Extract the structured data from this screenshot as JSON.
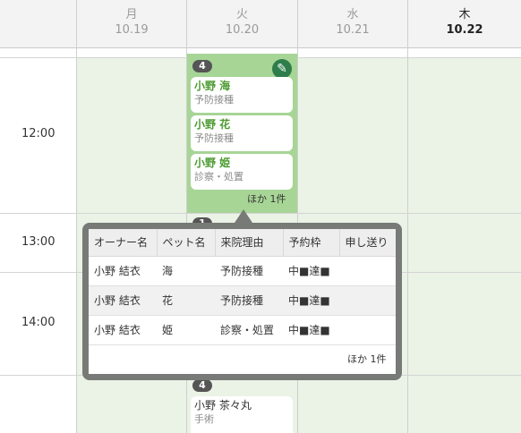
{
  "header": {
    "days": [
      {
        "dow": "月",
        "date": "10.19"
      },
      {
        "dow": "火",
        "date": "10.20"
      },
      {
        "dow": "水",
        "date": "10.21"
      },
      {
        "dow": "木",
        "date": "10.22"
      }
    ]
  },
  "time_labels": [
    "12:00",
    "13:00",
    "14:00"
  ],
  "slot_block": {
    "count": "4",
    "edit_icon": "pencil-icon",
    "cards": [
      {
        "name": "小野 海",
        "type": "予防接種"
      },
      {
        "name": "小野 花",
        "type": "予防接種"
      },
      {
        "name": "小野 姫",
        "type": "診察・処置"
      }
    ],
    "more": "ほか 1件"
  },
  "hidden_badge": "1",
  "lower_block": {
    "count": "4",
    "card": {
      "name": "小野 茶々丸",
      "type": "手術"
    }
  },
  "popover": {
    "columns": [
      "オーナー名",
      "ペット名",
      "来院理由",
      "予約枠",
      "申し送り"
    ],
    "rows": [
      {
        "owner": "小野 結衣",
        "pet": "海",
        "reason": "予防接種",
        "slot": "中■達■",
        "note": ""
      },
      {
        "owner": "小野 結衣",
        "pet": "花",
        "reason": "予防接種",
        "slot": "中■達■",
        "note": ""
      },
      {
        "owner": "小野 結衣",
        "pet": "姫",
        "reason": "診察・処置",
        "slot": "中■達■",
        "note": ""
      }
    ],
    "more": "ほか 1件"
  },
  "colors": {
    "accent_green": "#4a9a2e",
    "block_green": "#a7d596",
    "column_tint": "#eaf3e6",
    "edit_button": "#2e7d4b",
    "popover_border": "#777a77"
  }
}
